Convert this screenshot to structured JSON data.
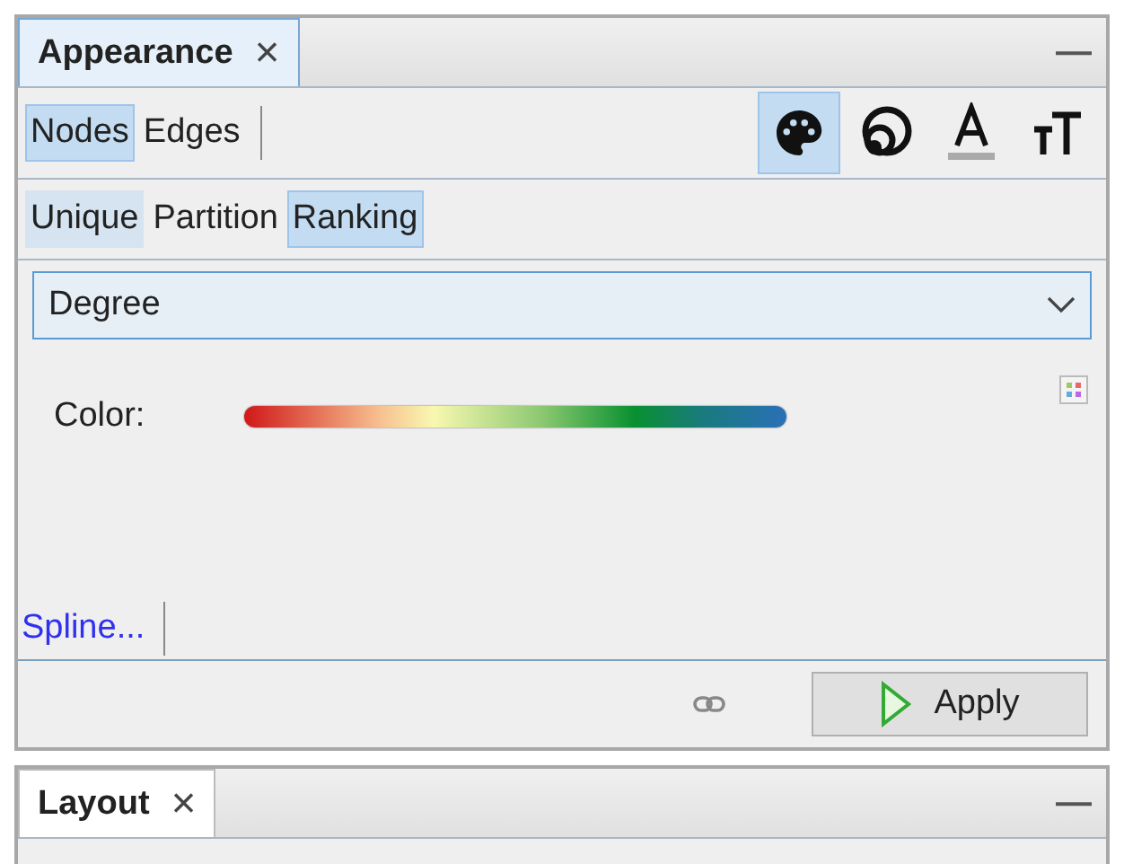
{
  "appearance_panel": {
    "tab": {
      "label": "Appearance",
      "close": "×"
    },
    "minimize": "—",
    "element_tabs": [
      {
        "label": "Nodes",
        "selected": true
      },
      {
        "label": "Edges",
        "selected": false
      }
    ],
    "attribute_buttons": [
      {
        "kind": "palette",
        "selected": true
      },
      {
        "kind": "size",
        "selected": false
      },
      {
        "kind": "label-color",
        "selected": false
      },
      {
        "kind": "label-size",
        "selected": false
      }
    ],
    "mode_tabs": [
      {
        "label": "Unique",
        "selected": false,
        "hovered": true
      },
      {
        "label": "Partition",
        "selected": false,
        "hovered": false
      },
      {
        "label": "Ranking",
        "selected": true,
        "hovered": false
      }
    ],
    "attribute_dropdown": {
      "value": "Degree"
    },
    "color_label": "Color:",
    "spline_link": "Spline...",
    "apply_button": "Apply"
  },
  "layout_panel": {
    "tab": {
      "label": "Layout",
      "close": "×"
    },
    "minimize": "—"
  }
}
